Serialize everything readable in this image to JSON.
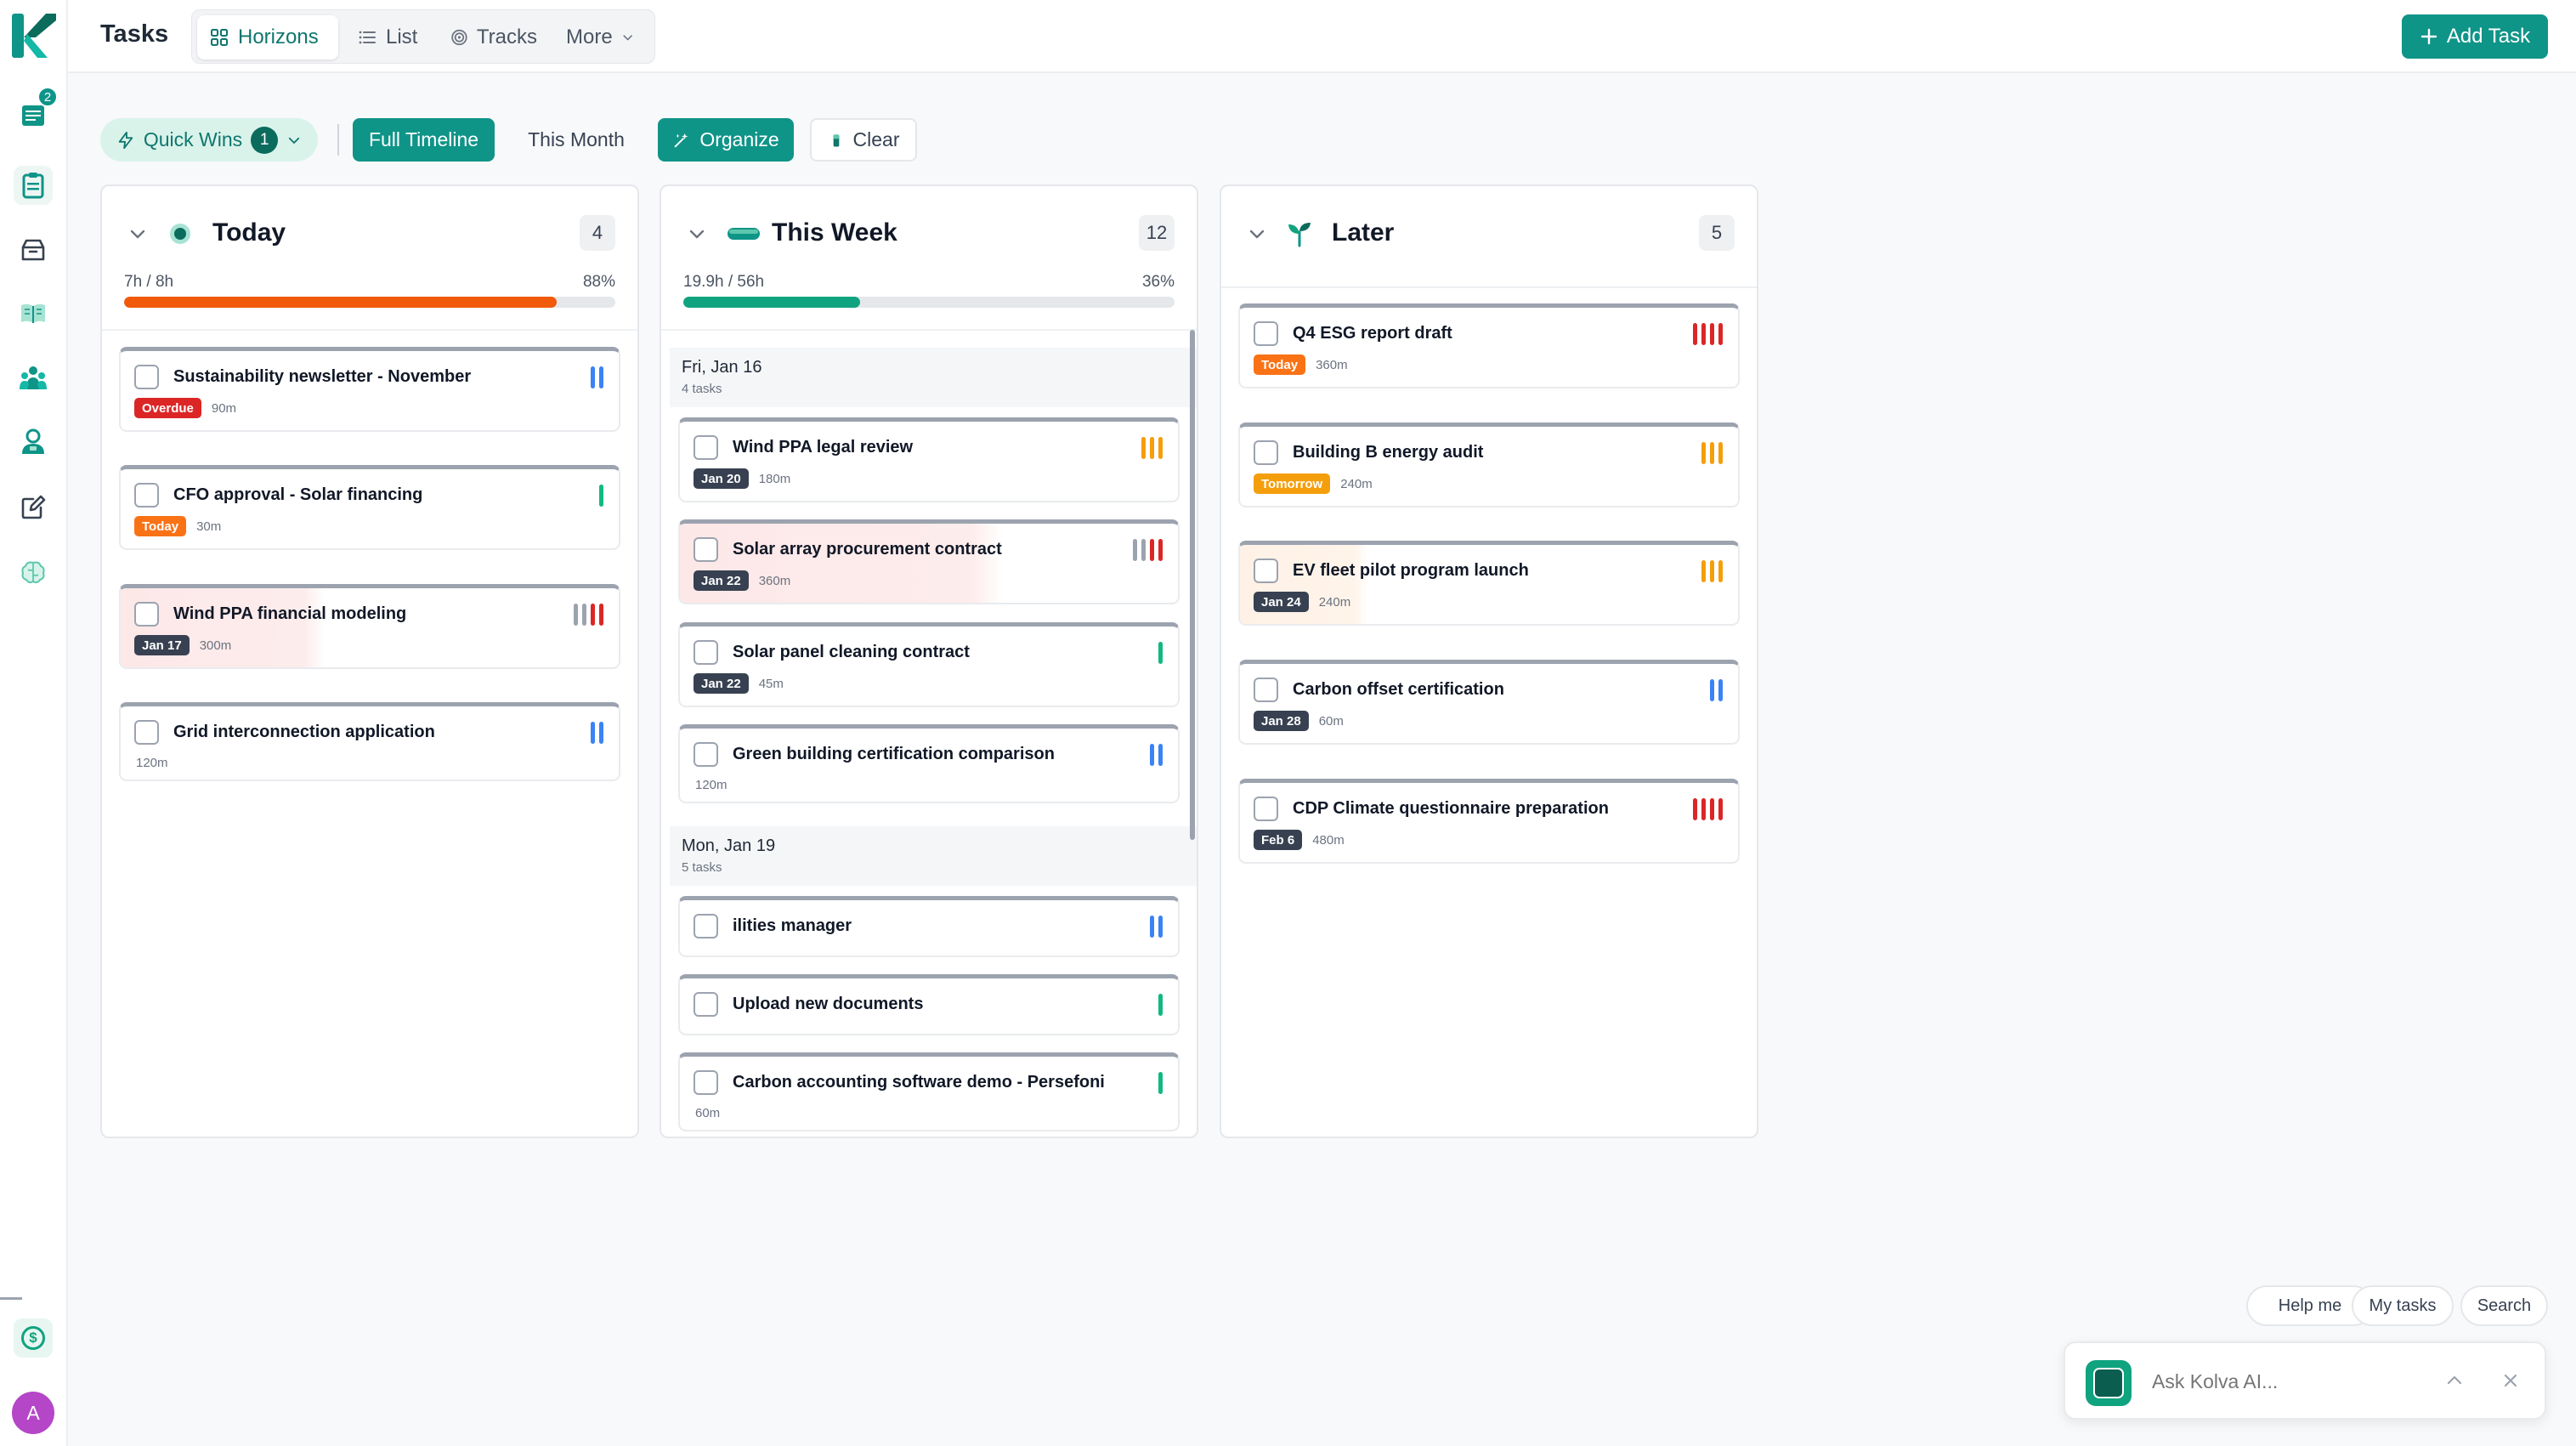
{
  "app": {
    "title": "Tasks",
    "notification_count": "2",
    "avatar_letter": "A",
    "currency_symbol": "$"
  },
  "tabs": [
    {
      "label": "Horizons",
      "icon": "grid-icon",
      "active": true
    },
    {
      "label": "List",
      "icon": "list-icon",
      "active": false
    },
    {
      "label": "Tracks",
      "icon": "target-icon",
      "active": false
    },
    {
      "label": "More",
      "icon": "chevron-down-icon",
      "active": false
    }
  ],
  "header": {
    "add_task_label": "Add Task"
  },
  "filters": {
    "quick_wins_label": "Quick Wins",
    "quick_wins_count": "1",
    "full_timeline_label": "Full Timeline",
    "this_month_label": "This Month",
    "organize_label": "Organize",
    "clear_label": "Clear"
  },
  "colors": {
    "accent": "#0f9488",
    "danger": "#dc2626",
    "warning": "#f97316",
    "amber": "#f59e0b",
    "info": "#3b82f6",
    "success": "#10b981",
    "neutral": "#9ca3af"
  },
  "columns": {
    "today": {
      "title": "Today",
      "count": "4",
      "capacity_label": "7h / 8h",
      "percent_label": "88%",
      "progress": 0.88,
      "cards": [
        {
          "title": "Sustainability newsletter - November",
          "badge": "Overdue",
          "duration": "90m",
          "priority": "medium"
        },
        {
          "title": "CFO approval - Solar financing",
          "badge": "Today",
          "duration": "30m",
          "priority": "low"
        },
        {
          "title": "Wind PPA financial modeling",
          "badge": "Jan 17",
          "duration": "300m",
          "priority": "critical"
        },
        {
          "title": "Grid interconnection application",
          "badge": "",
          "duration": "120m",
          "priority": "medium"
        }
      ]
    },
    "week": {
      "title": "This Week",
      "count": "12",
      "capacity_label": "19.9h / 56h",
      "percent_label": "36%",
      "progress": 0.36,
      "groups": [
        {
          "title": "Fri, Jan 16",
          "subtitle": "4 tasks"
        },
        {
          "title": "Mon, Jan 19",
          "subtitle": "5 tasks"
        }
      ],
      "cards": [
        {
          "title": "Wind PPA legal review",
          "badge": "Jan 20",
          "duration": "180m",
          "priority": "high"
        },
        {
          "title": "Solar array procurement contract",
          "badge": "Jan 22",
          "duration": "360m",
          "priority": "critical"
        },
        {
          "title": "Solar panel cleaning contract",
          "badge": "Jan 22",
          "duration": "45m",
          "priority": "low"
        },
        {
          "title": "Green building certification comparison",
          "badge": "",
          "duration": "120m",
          "priority": "medium"
        },
        {
          "title": "ilities manager",
          "badge": "",
          "duration": "",
          "priority": "medium"
        },
        {
          "title": "Upload new documents",
          "badge": "",
          "duration": "",
          "priority": "low"
        },
        {
          "title": "Carbon accounting software demo - Persefoni",
          "badge": "",
          "duration": "60m",
          "priority": "low"
        }
      ]
    },
    "later": {
      "title": "Later",
      "count": "5",
      "cards": [
        {
          "title": "Q4 ESG report draft",
          "badge": "Today",
          "duration": "360m",
          "priority": "urgent"
        },
        {
          "title": "Building B energy audit",
          "badge": "Tomorrow",
          "duration": "240m",
          "priority": "high"
        },
        {
          "title": "EV fleet pilot program launch",
          "badge": "Jan 24",
          "duration": "240m",
          "priority": "high"
        },
        {
          "title": "Carbon offset certification",
          "badge": "Jan 28",
          "duration": "60m",
          "priority": "medium"
        },
        {
          "title": "CDP Climate questionnaire preparation",
          "badge": "Feb 6",
          "duration": "480m",
          "priority": "urgent"
        }
      ]
    }
  },
  "assistant": {
    "quick_actions": [
      "Help me",
      "My tasks",
      "Search"
    ],
    "placeholder": "Ask Kolva AI..."
  }
}
